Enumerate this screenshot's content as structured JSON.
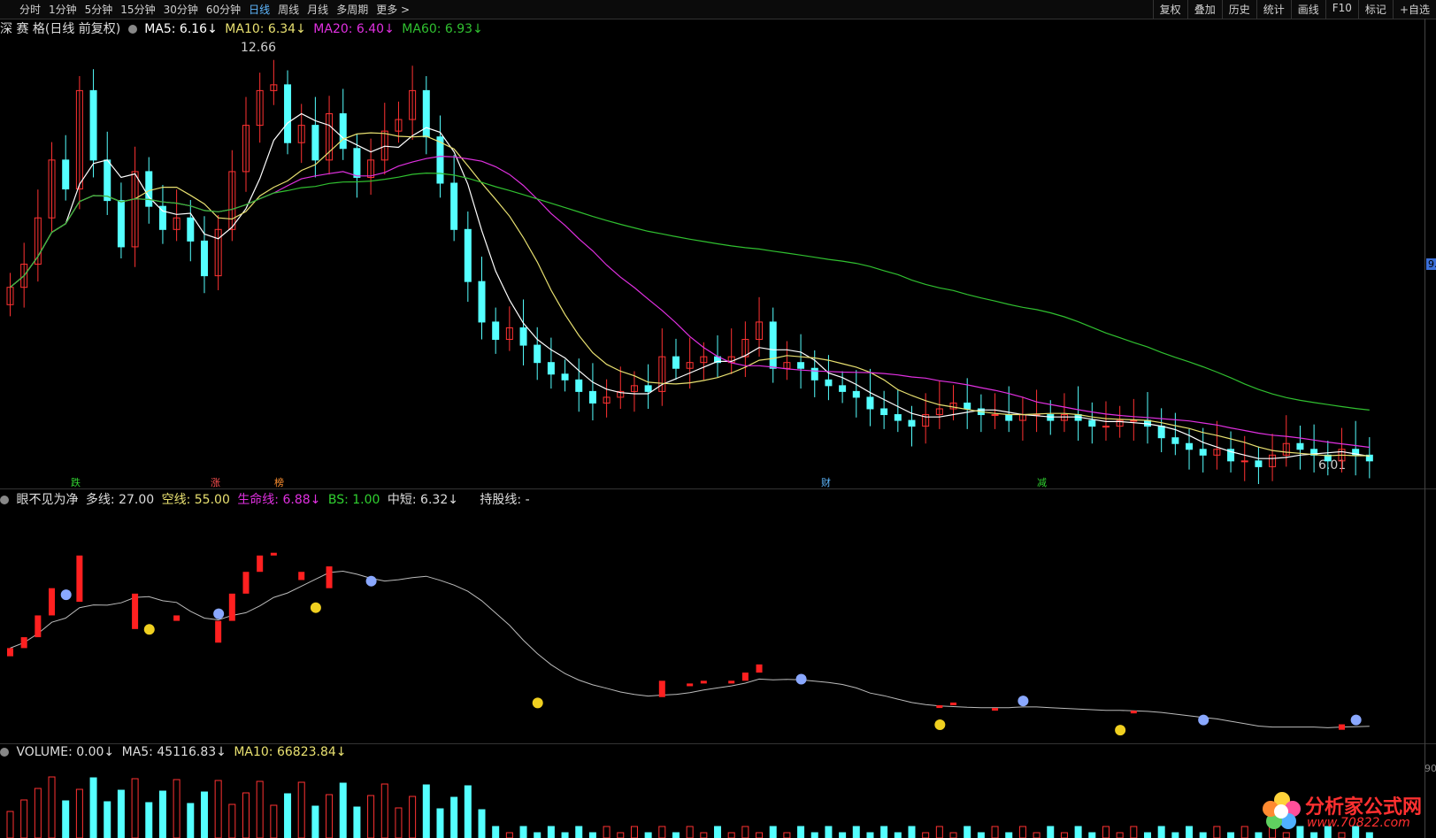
{
  "toolbar": {
    "periods": [
      "分时",
      "1分钟",
      "5分钟",
      "15分钟",
      "30分钟",
      "60分钟",
      "日线",
      "周线",
      "月线",
      "多周期",
      "更多 >"
    ],
    "active": "日线",
    "right": [
      "复权",
      "叠加",
      "历史",
      "统计",
      "画线",
      "F10",
      "标记",
      "+自选"
    ]
  },
  "main": {
    "title": "深 赛 格(日线 前复权)",
    "ma5": "MA5: 6.16",
    "ma10": "MA10: 6.34",
    "ma20": "MA20: 6.40",
    "ma60": "MA60: 6.93",
    "high_label": "12.66",
    "low_label": "6.01",
    "price_tag": "9.",
    "markers": [
      "跌",
      "涨",
      "榜",
      "财",
      "减"
    ]
  },
  "ind": {
    "name": "眼不见为净",
    "duo": "多线: 27.00",
    "kong": "空线: 55.00",
    "sml": "生命线: 6.88",
    "bs": "BS: 1.00",
    "zd": "中短: 6.32",
    "cg": "持股线: -"
  },
  "vol": {
    "v": "VOLUME: 0.00",
    "ma5": "MA5: 45116.83",
    "ma10": "MA10: 66823.84",
    "axis_label": "90"
  },
  "logo": {
    "name": "分析家公式网",
    "url": "www.70822.com"
  },
  "colors": {
    "up": "#ff3232",
    "down": "#54ffff",
    "ma5": "#ffffff",
    "ma10": "#e8e070",
    "ma20": "#e030e0",
    "ma60": "#30c030"
  },
  "chart_data": {
    "type": "candlestick",
    "closes": [
      8.8,
      9.2,
      10.0,
      11.0,
      10.5,
      12.2,
      11.0,
      10.3,
      9.5,
      10.8,
      10.2,
      9.8,
      10.0,
      9.6,
      9.0,
      9.8,
      10.8,
      11.6,
      12.2,
      12.3,
      11.3,
      11.6,
      11.0,
      11.8,
      11.2,
      10.7,
      11.0,
      11.5,
      11.7,
      12.2,
      11.4,
      10.6,
      9.8,
      8.9,
      8.2,
      7.9,
      8.1,
      7.8,
      7.5,
      7.3,
      7.2,
      7.0,
      6.8,
      6.9,
      7.0,
      7.1,
      7.0,
      7.6,
      7.4,
      7.5,
      7.6,
      7.5,
      7.6,
      7.9,
      8.2,
      7.4,
      7.5,
      7.4,
      7.2,
      7.1,
      7.0,
      6.9,
      6.7,
      6.6,
      6.5,
      6.4,
      6.6,
      6.7,
      6.8,
      6.7,
      6.6,
      6.6,
      6.5,
      6.6,
      6.6,
      6.5,
      6.6,
      6.5,
      6.4,
      6.4,
      6.5,
      6.5,
      6.4,
      6.2,
      6.1,
      6.0,
      5.9,
      6.0,
      5.8,
      5.8,
      5.7,
      5.9,
      6.1,
      6.0,
      5.9,
      5.8,
      6.0,
      5.9,
      5.8
    ],
    "ylim": [
      6.01,
      12.66
    ]
  }
}
